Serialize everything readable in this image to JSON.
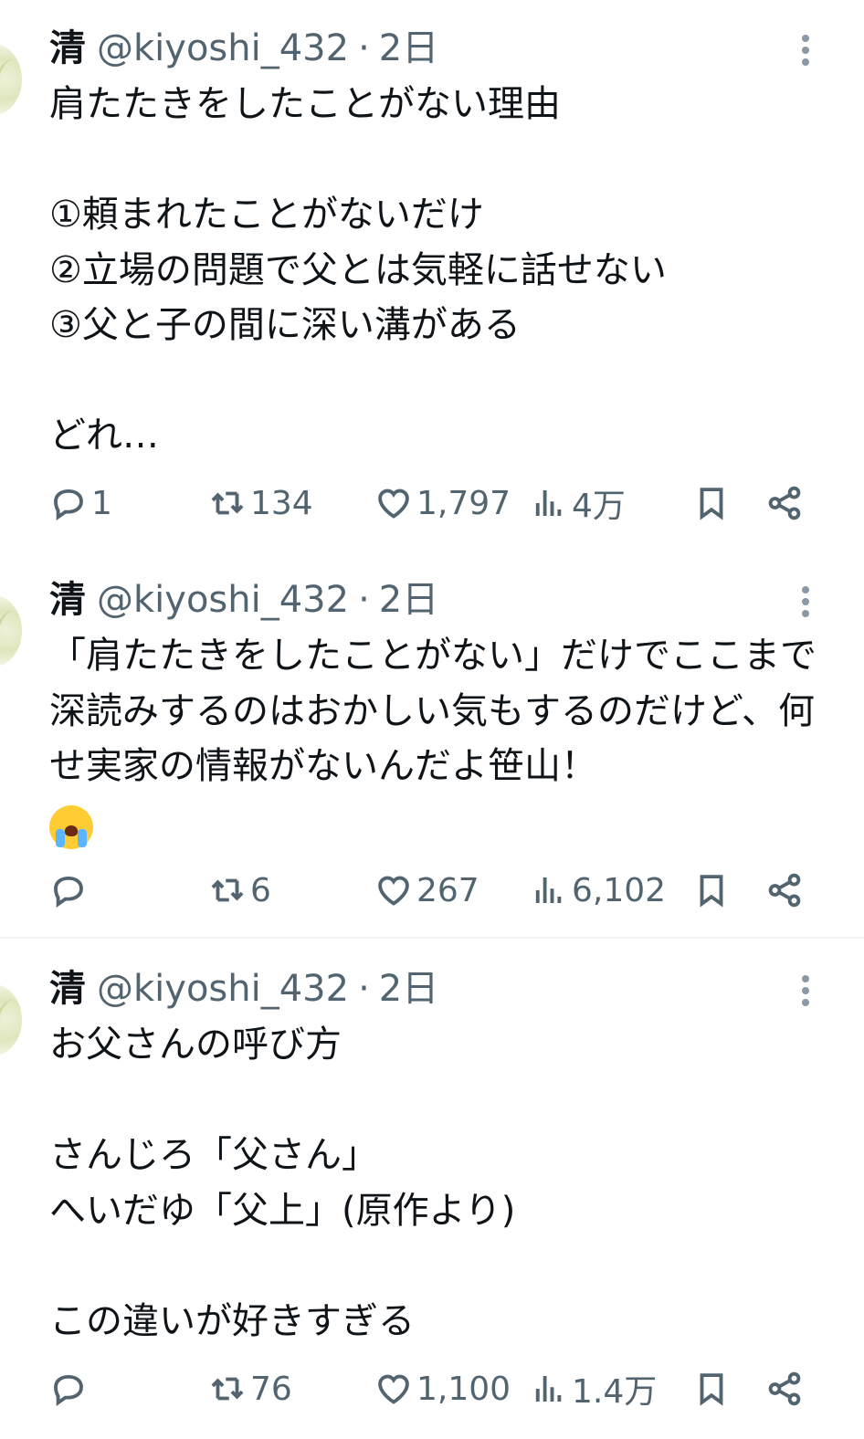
{
  "tweets": [
    {
      "display_name": "清",
      "handle": "@kiyoshi_432",
      "separator": "·",
      "time": "2日",
      "text": "肩たたきをしたことがない理由\n\n①頼まれたことがないだけ\n②立場の問題で父とは気軽に話せない\n③父と子の間に深い溝がある\n\nどれ…",
      "emoji": "",
      "reply_count": "1",
      "retweet_count": "134",
      "like_count": "1,797",
      "view_count": "4万"
    },
    {
      "display_name": "清",
      "handle": "@kiyoshi_432",
      "separator": "·",
      "time": "2日",
      "text": "「肩たたきをしたことがない」だけでここまで深読みするのはおかしい気もするのだけど、何せ実家の情報がないんだよ笹山！",
      "emoji": "loudly-crying-face",
      "reply_count": "",
      "retweet_count": "6",
      "like_count": "267",
      "view_count": "6,102"
    },
    {
      "display_name": "清",
      "handle": "@kiyoshi_432",
      "separator": "·",
      "time": "2日",
      "text": "お父さんの呼び方\n\nさんじろ「父さん」\nへいだゆ「父上」(原作より)\n\nこの違いが好きすぎる",
      "emoji": "",
      "reply_count": "",
      "retweet_count": "76",
      "like_count": "1,100",
      "view_count": "1.4万"
    }
  ],
  "icons": {
    "reply": "speech-bubble-icon",
    "retweet": "retweet-arrows-icon",
    "like": "heart-icon",
    "views": "bar-chart-icon",
    "bookmark": "bookmark-icon",
    "share": "share-nodes-icon",
    "more": "vertical-dots-icon"
  },
  "colors": {
    "text": "#0f1419",
    "secondary": "#536471",
    "divider": "#eff3f4"
  }
}
